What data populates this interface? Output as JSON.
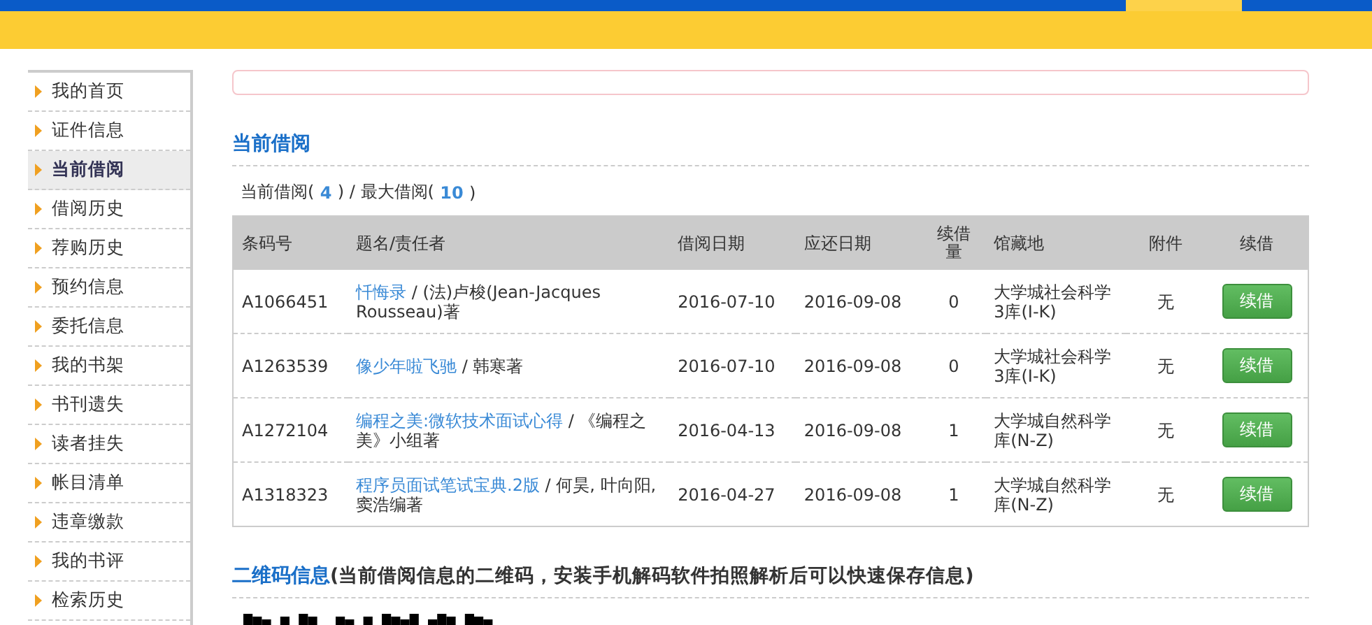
{
  "sidebar": {
    "items": [
      {
        "label": "我的首页",
        "selected": false
      },
      {
        "label": "证件信息",
        "selected": false
      },
      {
        "label": "当前借阅",
        "selected": true
      },
      {
        "label": "借阅历史",
        "selected": false
      },
      {
        "label": "荐购历史",
        "selected": false
      },
      {
        "label": "预约信息",
        "selected": false
      },
      {
        "label": "委托信息",
        "selected": false
      },
      {
        "label": "我的书架",
        "selected": false
      },
      {
        "label": "书刊遗失",
        "selected": false
      },
      {
        "label": "读者挂失",
        "selected": false
      },
      {
        "label": "帐目清单",
        "selected": false
      },
      {
        "label": "违章缴款",
        "selected": false
      },
      {
        "label": "我的书评",
        "selected": false
      },
      {
        "label": "检索历史",
        "selected": false
      }
    ]
  },
  "section_title": "当前借阅",
  "counts": {
    "current_label": "当前借阅(",
    "current": "4",
    "max_label": ") / 最大借阅(",
    "max": "10",
    "close": ")"
  },
  "table": {
    "columns": [
      "条码号",
      "题名/责任者",
      "借阅日期",
      "应还日期",
      "续借量",
      "馆藏地",
      "附件",
      "续借"
    ],
    "rows": [
      {
        "barcode": "A1066451",
        "title": "忏悔录",
        "author": "/ (法)卢梭(Jean-Jacques Rousseau)著",
        "borrowed": "2016-07-10",
        "due": "2016-09-08",
        "renewals": "0",
        "location": "大学城社会科学3库(I-K)",
        "attachment": "无",
        "button": "续借"
      },
      {
        "barcode": "A1263539",
        "title": "像少年啦飞驰",
        "author": "/ 韩寒著",
        "borrowed": "2016-07-10",
        "due": "2016-09-08",
        "renewals": "0",
        "location": "大学城社会科学3库(I-K)",
        "attachment": "无",
        "button": "续借"
      },
      {
        "barcode": "A1272104",
        "title": "编程之美:微软技术面试心得",
        "author": "/ 《编程之美》小组著",
        "borrowed": "2016-04-13",
        "due": "2016-09-08",
        "renewals": "1",
        "location": "大学城自然科学库(N-Z)",
        "attachment": "无",
        "button": "续借"
      },
      {
        "barcode": "A1318323",
        "title": "程序员面试笔试宝典.2版",
        "author": "/ 何昊, 叶向阳, 窦浩编著",
        "borrowed": "2016-04-27",
        "due": "2016-09-08",
        "renewals": "1",
        "location": "大学城自然科学库(N-Z)",
        "attachment": "无",
        "button": "续借"
      }
    ]
  },
  "qr_section": {
    "title": "二维码信息",
    "subtitle": "(当前借阅信息的二维码，安装手机解码软件拍照解析后可以快速保存信息)"
  }
}
